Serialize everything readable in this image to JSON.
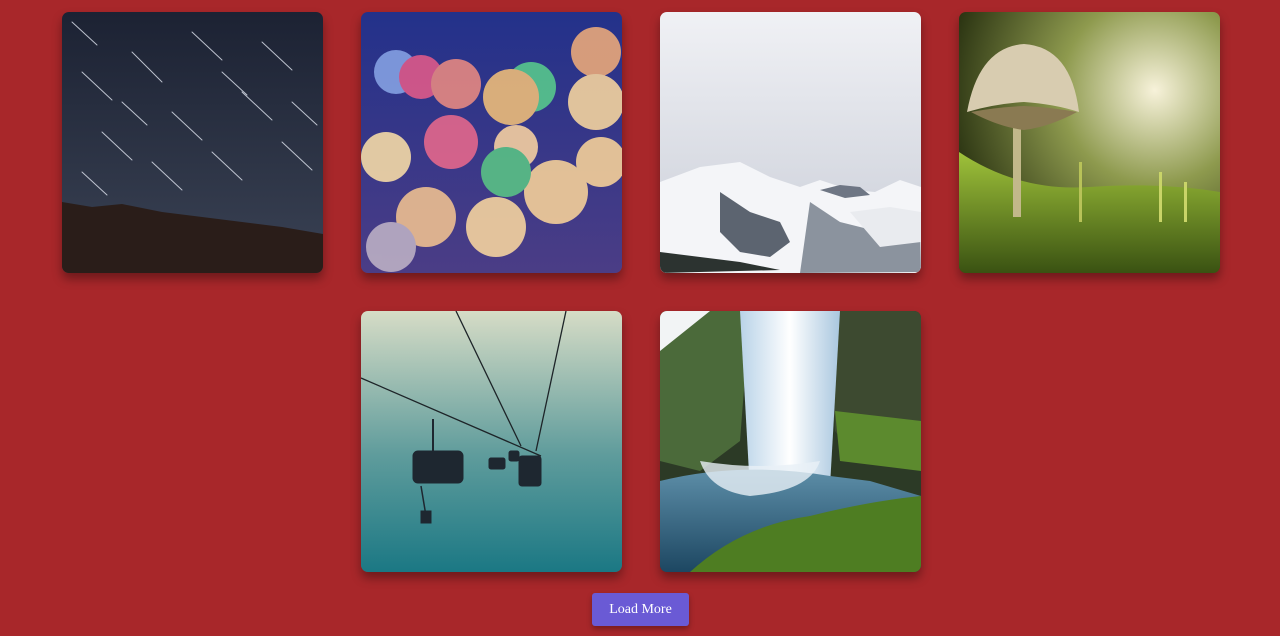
{
  "gallery": {
    "images": [
      {
        "subject": "star-trails-night-sky"
      },
      {
        "subject": "colorful-bokeh-lights"
      },
      {
        "subject": "snowy-mountains"
      },
      {
        "subject": "mushroom-on-moss"
      },
      {
        "subject": "ski-chairlift"
      },
      {
        "subject": "waterfall"
      }
    ],
    "load_more_label": "Load More"
  },
  "colors": {
    "background": "#a8272a",
    "button": "#6a5ad5",
    "button_text": "#ffffff"
  }
}
